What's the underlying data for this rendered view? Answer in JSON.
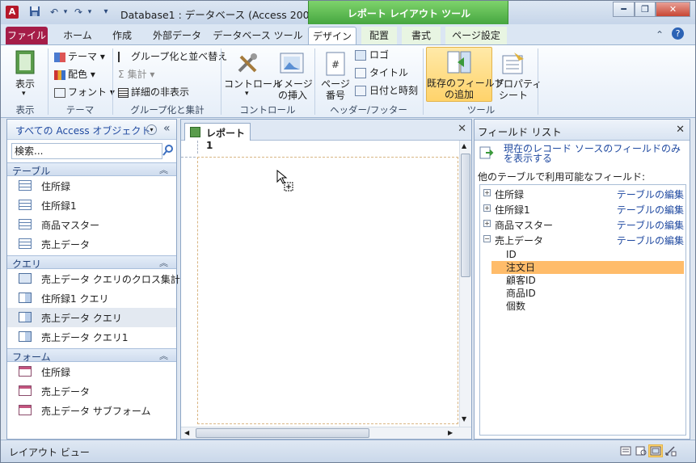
{
  "title_bar": {
    "app_icon_letter": "A",
    "title": "Database1 : データベース (Access 200...",
    "context_title": "レポート レイアウト ツール"
  },
  "tabs": [
    {
      "label": "ファイル"
    },
    {
      "label": "ホーム"
    },
    {
      "label": "作成"
    },
    {
      "label": "外部データ"
    },
    {
      "label": "データベース ツール"
    },
    {
      "label": "デザイン"
    },
    {
      "label": "配置"
    },
    {
      "label": "書式"
    },
    {
      "label": "ページ設定"
    }
  ],
  "ribbon": {
    "view_label": "表示",
    "theme": "テーマ",
    "color": "配色",
    "font": "フォント",
    "group_sort": "グループ化と並べ替え",
    "totals": "集計",
    "hide_details": "詳細の非表示",
    "controls": "コントロール",
    "insert_image_1": "イメージ",
    "insert_image_2": "の挿入",
    "page_number_1": "ページ",
    "page_number_2": "番号",
    "logo": "ロゴ",
    "title": "タイトル",
    "date_time": "日付と時刻",
    "add_fields_1": "既存のフィールド",
    "add_fields_2": "の追加",
    "property_1": "プロパティ",
    "property_2": "シート",
    "groups": {
      "view": "表示",
      "themes": "テーマ",
      "grouping": "グループ化と集計",
      "controls": "コントロール",
      "header_footer": "ヘッダー/フッター",
      "tools": "ツール"
    }
  },
  "nav": {
    "title": "すべての Access オブジェクト",
    "search_value": "検索...",
    "sections": [
      {
        "label": "テーブル",
        "items": [
          "住所録",
          "住所録1",
          "商品マスター",
          "売上データ"
        ]
      },
      {
        "label": "クエリ",
        "items": [
          "売上データ クエリのクロス集計",
          "住所録1 クエリ",
          "売上データ クエリ",
          "売上データ クエリ1"
        ]
      },
      {
        "label": "フォーム",
        "items": [
          "住所録",
          "売上データ",
          "売上データ サブフォーム"
        ]
      }
    ]
  },
  "document": {
    "tab_label": "レポート1"
  },
  "field_list": {
    "title": "フィールド リスト",
    "link": "現在のレコード ソースのフィールドのみを表示する",
    "available": "他のテーブルで利用可能なフィールド:",
    "edit_label": "テーブルの編集",
    "tables": [
      {
        "name": "住所録",
        "expanded": false
      },
      {
        "name": "住所録1",
        "expanded": false
      },
      {
        "name": "商品マスター",
        "expanded": false
      },
      {
        "name": "売上データ",
        "expanded": true
      }
    ],
    "fields": [
      "ID",
      "注文日",
      "顧客ID",
      "商品ID",
      "個数"
    ],
    "selected_field": "注文日"
  },
  "status": {
    "text": "レイアウト ビュー"
  },
  "colors": {
    "file_tab": "#a51d48",
    "context_green": "#46a640",
    "selected_field": "#ffbc6a",
    "link": "#1f49a0"
  }
}
